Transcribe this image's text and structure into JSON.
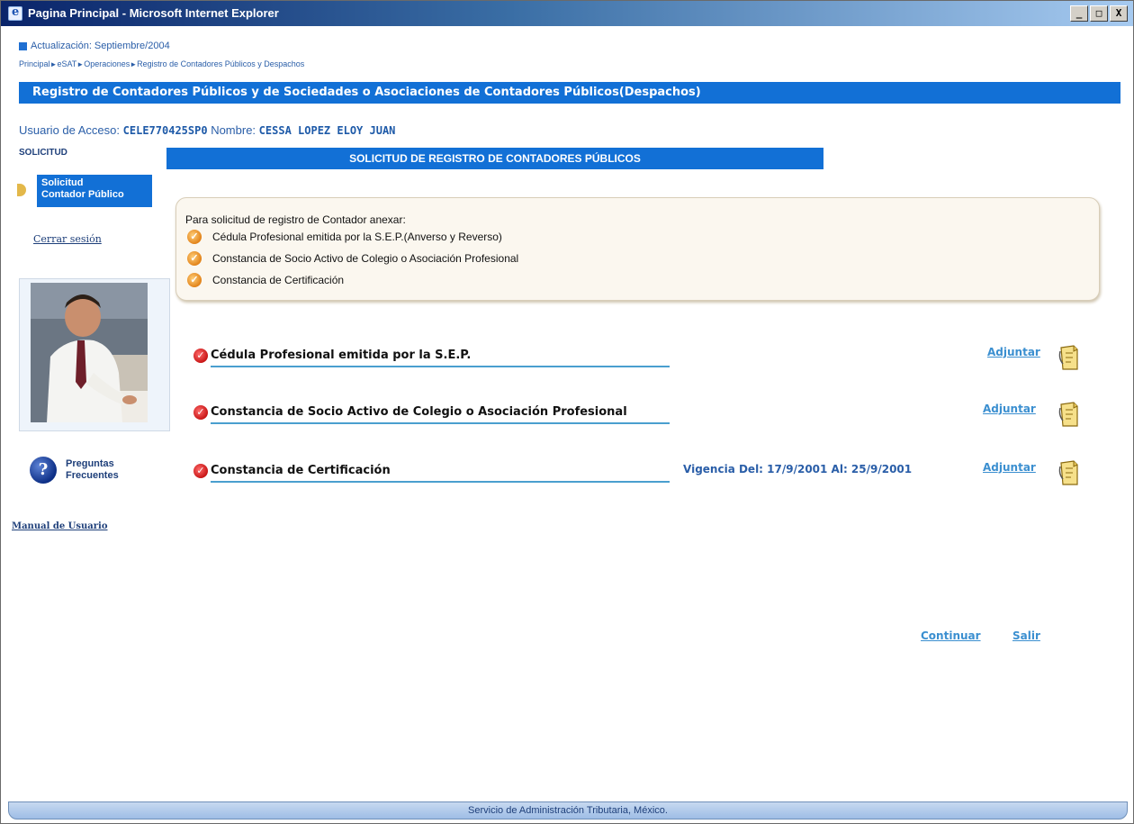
{
  "window": {
    "title": "Pagina Principal - Microsoft Internet Explorer",
    "controls": [
      "_",
      "□",
      "X"
    ]
  },
  "header": {
    "update": "Actualización: Septiembre/2004",
    "breadcrumb": [
      "Principal",
      "eSAT",
      "Operaciones",
      "Registro de Contadores Públicos y Despachos"
    ],
    "banner": "Registro de Contadores Públicos y de Sociedades o Asociaciones de Contadores Públicos(Despachos)"
  },
  "user": {
    "access_label": "Usuario de Acceso:",
    "access_value": "CELE770425SP0",
    "name_label": "Nombre:",
    "name_value": "CESSA LOPEZ ELOY JUAN"
  },
  "sidebar": {
    "heading": "SOLICITUD",
    "active_item_line1": "Solicitud",
    "active_item_line2": "Contador Público",
    "logout": "Cerrar sesión",
    "faq_line1": "Preguntas",
    "faq_line2": "Frecuentes",
    "manual": "Manual de Usuario"
  },
  "main": {
    "section_title": "SOLICITUD DE REGISTRO DE CONTADORES PÚBLICOS",
    "requirements": {
      "intro": "Para solicitud de registro de Contador anexar:",
      "items": [
        "Cédula Profesional emitida por la S.E.P.(Anverso y Reverso)",
        "Constancia de Socio Activo de Colegio o Asociación Profesional",
        "Constancia de Certificación"
      ]
    },
    "documents": [
      {
        "label": "Cédula Profesional emitida por la S.E.P.",
        "action": "Adjuntar"
      },
      {
        "label": "Constancia de Socio Activo de Colegio o Asociación Profesional",
        "action": "Adjuntar"
      },
      {
        "label": "Constancia de Certificación",
        "vigencia": "Vigencia Del: 17/9/2001 Al: 25/9/2001",
        "action": "Adjuntar"
      }
    ],
    "continue": "Continuar",
    "exit": "Salir"
  },
  "footer": "Servicio de Administración Tributaria, México.",
  "colors": {
    "banner_blue": "#1270d6",
    "link_blue": "#3b8fd0",
    "check_red": "#c40f0f",
    "check_orange": "#e07d12"
  },
  "icons": {
    "app": "ie-icon",
    "requirement": "orange-check-icon",
    "document": "red-check-icon",
    "attach": "paper-clip-document-icon",
    "faq": "question-mark-icon"
  }
}
